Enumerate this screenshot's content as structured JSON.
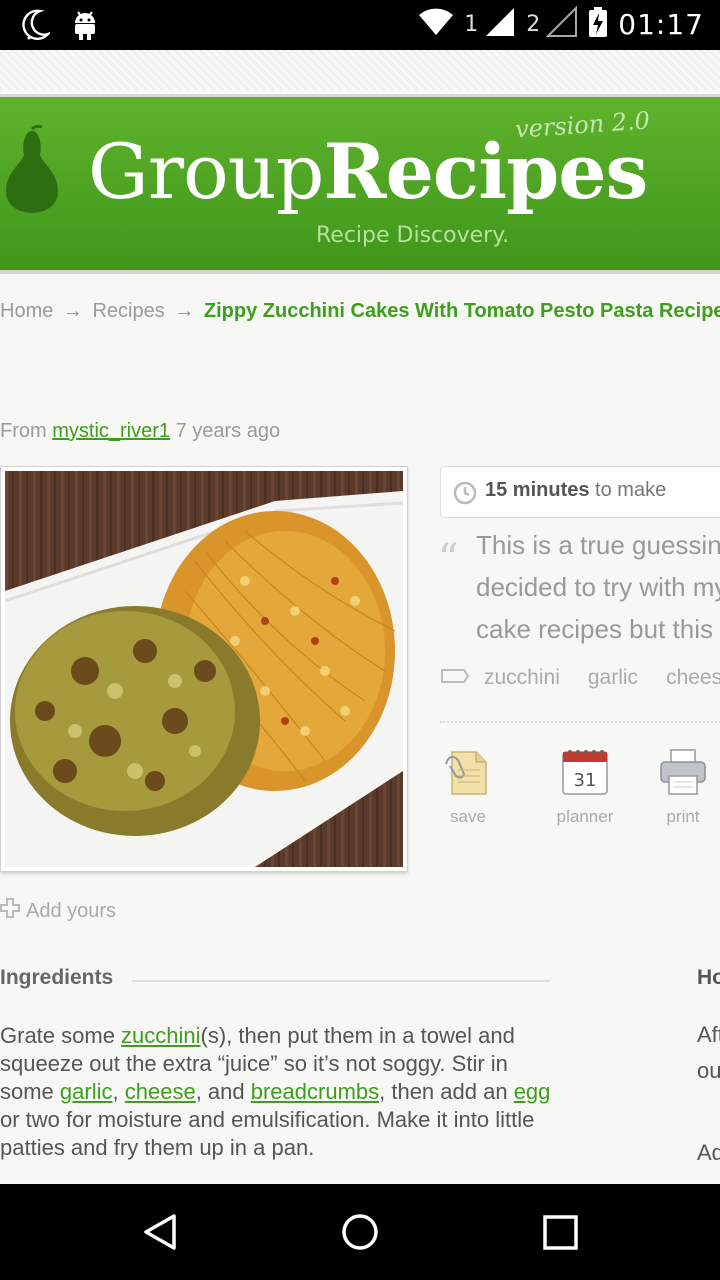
{
  "status_bar": {
    "time": "01:17",
    "sim1": "1",
    "sim2": "2",
    "icons": [
      "moon-icon",
      "android-icon",
      "wifi-icon",
      "signal-icon",
      "battery-charging-icon"
    ]
  },
  "header": {
    "logo_part1": "Group",
    "logo_part2": "Recipes",
    "version": "version 2.0",
    "tagline": "Recipe Discovery.",
    "brand_color": "#4ca622"
  },
  "breadcrumb": {
    "home": "Home",
    "recipes": "Recipes",
    "current": "Zippy Zucchini Cakes With Tomato Pesto Pasta Recipe"
  },
  "author": {
    "prefix": "From",
    "username": "mystic_river1",
    "age": "7 years ago"
  },
  "recipe": {
    "time_value": "15 minutes",
    "time_suffix": "to make",
    "description_lines": [
      "This is a true guessing game I",
      "decided to try with my zucchini",
      "cake recipes but this one turned"
    ],
    "tags": [
      "zucchini",
      "garlic",
      "cheese"
    ],
    "actions": {
      "save": "save",
      "planner": "planner",
      "planner_day": "31",
      "print": "print"
    },
    "add_yours": "Add yours"
  },
  "ingredients": {
    "title": "Ingredients",
    "t1": "Grate some ",
    "l1": "zucchini",
    "t2": "(s), then put them in a towel and squeeze out the extra “juice” so it’s not soggy. Stir in some ",
    "l2": "garlic",
    "t3": ", ",
    "l3": "cheese",
    "t4": ", and ",
    "l4": "breadcrumbs",
    "t5": ", then add an ",
    "l5": "egg",
    "t6": " or two for moisture and emulsification. Make it into little patties and fry them up in a pan."
  },
  "how_to": {
    "title": "How to make it",
    "line1": "After frying",
    "line2": "out",
    "line3": "Add"
  }
}
